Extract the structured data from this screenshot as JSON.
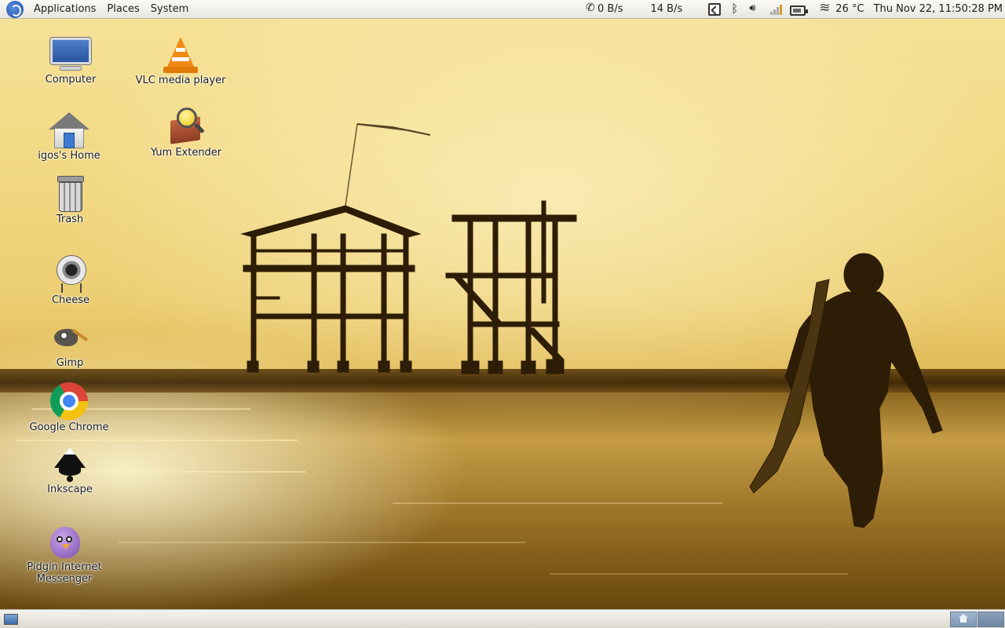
{
  "top_panel": {
    "menus": [
      "Applications",
      "Places",
      "System"
    ],
    "net_down": "0 B/s",
    "net_up": "14 B/s",
    "tray_icons": [
      "display-icon",
      "bluetooth-icon",
      "volume-icon",
      "signal-icon",
      "battery-icon",
      "weather-icon"
    ],
    "temperature": "26 °C",
    "clock": "Thu Nov 22, 11:50:28 PM"
  },
  "desktop": {
    "icons": [
      {
        "label": "Computer",
        "icon": "computer-icon"
      },
      {
        "label": "VLC media player",
        "icon": "vlc-icon"
      },
      {
        "label": "igos's Home",
        "icon": "home-folder-icon"
      },
      {
        "label": "Yum Extender",
        "icon": "yum-extender-icon"
      },
      {
        "label": "Trash",
        "icon": "trash-icon"
      },
      {
        "label": "Cheese",
        "icon": "cheese-webcam-icon"
      },
      {
        "label": "Gimp",
        "icon": "gimp-icon"
      },
      {
        "label": "Google Chrome",
        "icon": "chrome-icon"
      },
      {
        "label": "Inkscape",
        "icon": "inkscape-icon"
      },
      {
        "label": "Pidgin Internet Messenger",
        "icon": "pidgin-icon"
      }
    ]
  },
  "bottom_panel": {
    "workspaces": 2,
    "active_workspace": 1
  },
  "colors": {
    "panel_bg": "#e8e6df",
    "sky": "#f2d984",
    "water": "#a27a2c",
    "silhouette": "#2e1d06"
  }
}
